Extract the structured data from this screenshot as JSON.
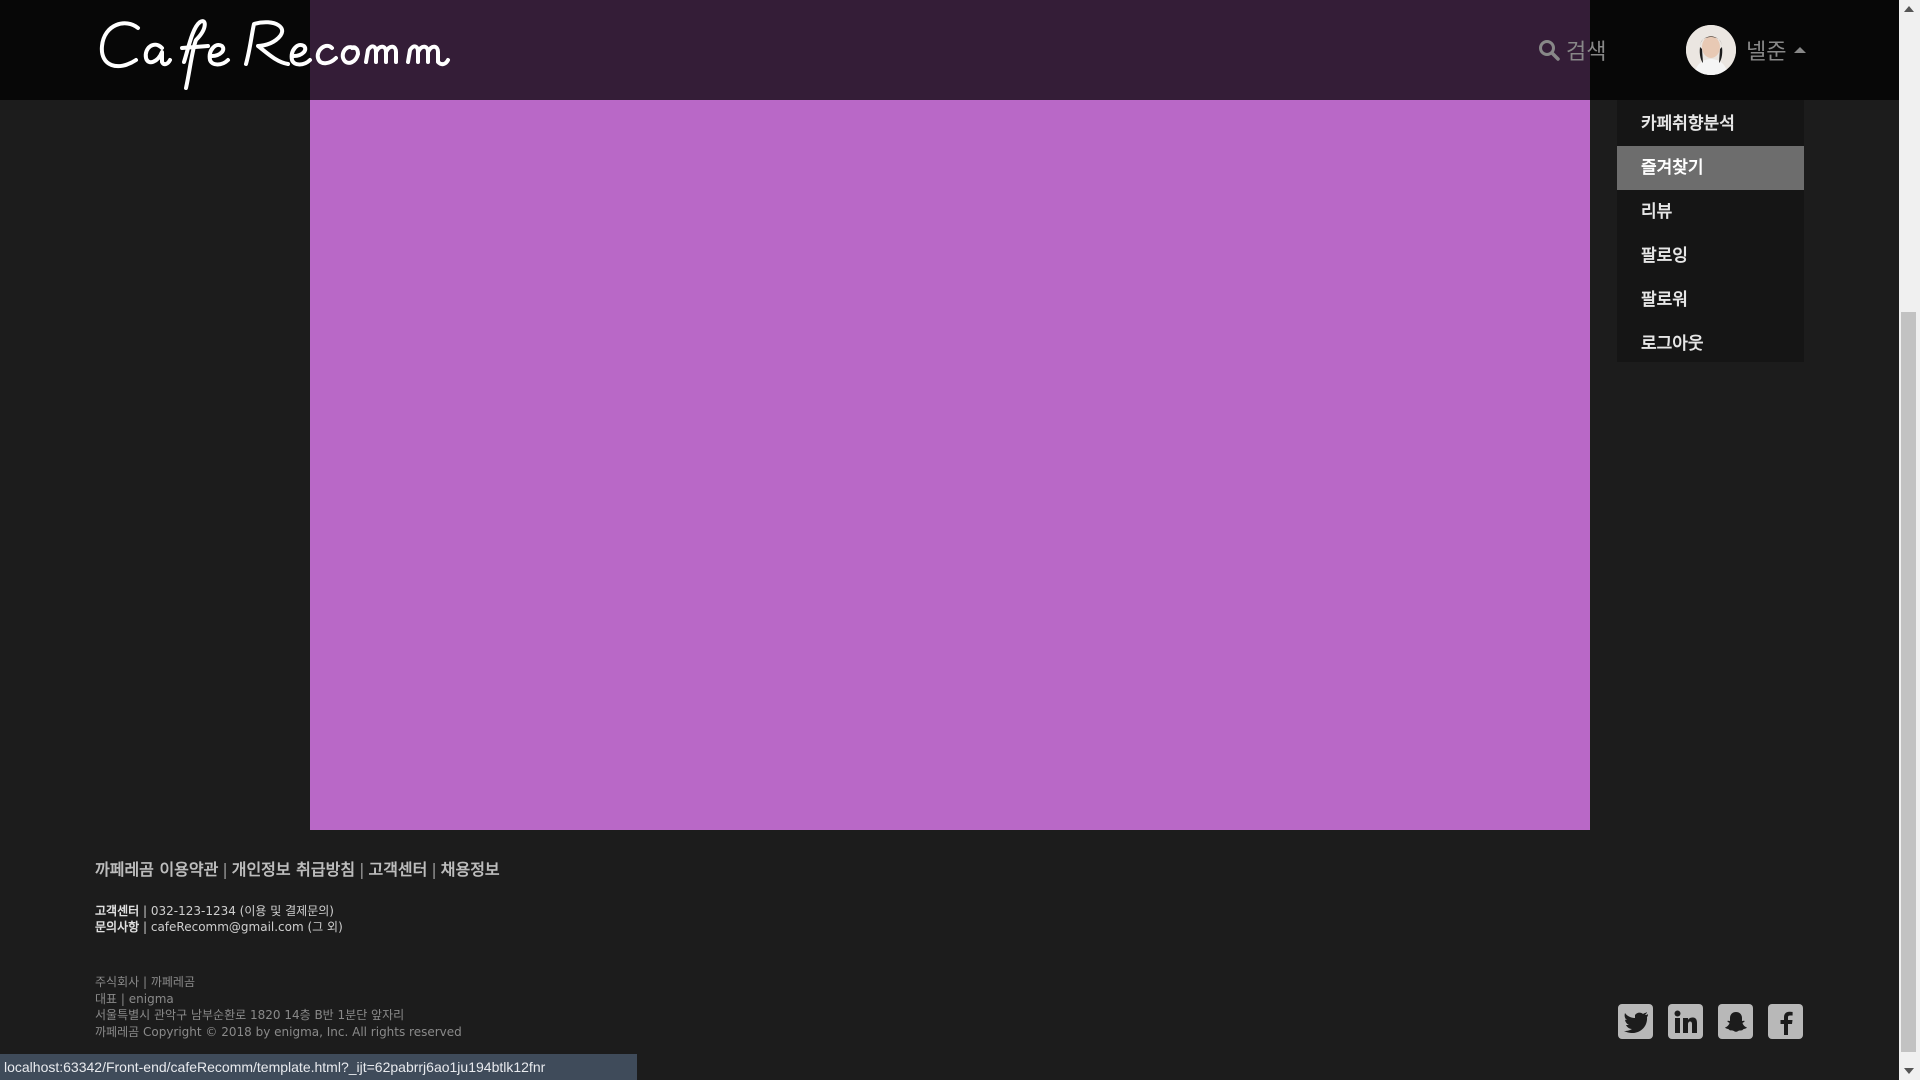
{
  "header": {
    "brand": "CafeRecomm",
    "search_label": "검색",
    "username": "넬준"
  },
  "dropdown": {
    "items": [
      {
        "label": "카페취향분석",
        "active": false
      },
      {
        "label": "즐겨찾기",
        "active": true
      },
      {
        "label": "리뷰",
        "active": false
      },
      {
        "label": "팔로잉",
        "active": false
      },
      {
        "label": "팔로워",
        "active": false
      },
      {
        "label": "로그아웃",
        "active": false
      }
    ]
  },
  "footer": {
    "links": [
      "까페레곰 이용약관",
      "개인정보 취급방침",
      "고객센터",
      "채용정보"
    ],
    "link_sep": "|",
    "contact": {
      "cs_label": "고객센터",
      "cs_value": "| 032-123-1234 (이용 및 결제문의)",
      "inquiry_label": "문의사항",
      "inquiry_value": "| cafeRecomm@gmail.com (그 외)"
    },
    "company": {
      "line1": "주식회사 | 까페레곰",
      "line2": "대표 | enigma",
      "line3": "서울특별시 관악구 남부순환로 1820 14층 B반 1분단 앞자리",
      "line4": "까페레곰 Copyright © 2018 by enigma, Inc. All rights reserved"
    },
    "social": [
      "twitter-icon",
      "linkedin-icon",
      "snapchat-icon",
      "facebook-icon"
    ]
  },
  "status_bar": {
    "url": "localhost:63342/Front-end/cafeRecomm/template.html?_ijt=62pabrrj6ao1ju194btlk12fnr"
  },
  "colors": {
    "content_panel": "#b968c7",
    "header_bg": "#000000",
    "menu_active": "#6d6d6d"
  }
}
